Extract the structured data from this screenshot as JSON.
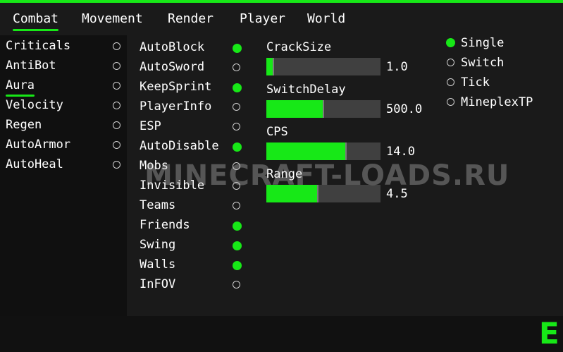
{
  "tabs": [
    "Combat",
    "Movement",
    "Render",
    "Player",
    "World"
  ],
  "active_tab": "Combat",
  "modules": [
    {
      "label": "Criticals",
      "enabled": false
    },
    {
      "label": "AntiBot",
      "enabled": false
    },
    {
      "label": "Aura",
      "enabled": false,
      "selected": true
    },
    {
      "label": "Velocity",
      "enabled": false
    },
    {
      "label": "Regen",
      "enabled": false
    },
    {
      "label": "AutoArmor",
      "enabled": false
    },
    {
      "label": "AutoHeal",
      "enabled": false
    }
  ],
  "settings": [
    {
      "label": "AutoBlock",
      "enabled": true
    },
    {
      "label": "AutoSword",
      "enabled": false
    },
    {
      "label": "KeepSprint",
      "enabled": true
    },
    {
      "label": "PlayerInfo",
      "enabled": false
    },
    {
      "label": "ESP",
      "enabled": false
    },
    {
      "label": "AutoDisable",
      "enabled": true
    },
    {
      "label": "Mobs",
      "enabled": false
    },
    {
      "label": "Invisible",
      "enabled": false
    },
    {
      "label": "Teams",
      "enabled": false
    },
    {
      "label": "Friends",
      "enabled": true
    },
    {
      "label": "Swing",
      "enabled": true
    },
    {
      "label": "Walls",
      "enabled": true
    },
    {
      "label": "InFOV",
      "enabled": false
    }
  ],
  "sliders": [
    {
      "label": "CrackSize",
      "value": "1.0",
      "fill": 0.06
    },
    {
      "label": "SwitchDelay",
      "value": "500.0",
      "fill": 0.5
    },
    {
      "label": "CPS",
      "value": "14.0",
      "fill": 0.7
    },
    {
      "label": "Range",
      "value": "4.5",
      "fill": 0.45
    }
  ],
  "modes": [
    {
      "label": "Single",
      "selected": true
    },
    {
      "label": "Switch",
      "selected": false
    },
    {
      "label": "Tick",
      "selected": false
    },
    {
      "label": "MineplexTP",
      "selected": false
    }
  ],
  "watermark": "MINECRAFT-LOADS.RU",
  "logo": "E",
  "colors": {
    "accent": "#17e817",
    "track": "#404040"
  }
}
